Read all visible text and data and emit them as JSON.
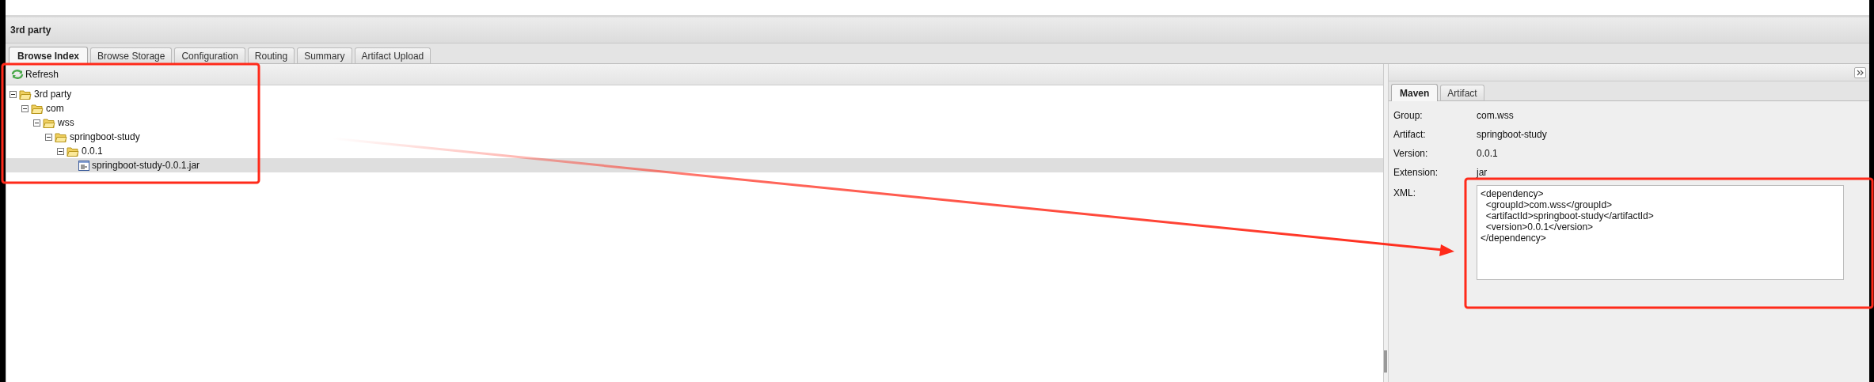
{
  "panel": {
    "title": "3rd party"
  },
  "tabs": [
    {
      "label": "Browse Index",
      "selected": true
    },
    {
      "label": "Browse Storage",
      "selected": false
    },
    {
      "label": "Configuration",
      "selected": false
    },
    {
      "label": "Routing",
      "selected": false
    },
    {
      "label": "Summary",
      "selected": false
    },
    {
      "label": "Artifact Upload",
      "selected": false
    }
  ],
  "toolbar": {
    "refresh": "Refresh"
  },
  "tree": [
    {
      "label": "3rd party",
      "kind": "folder",
      "expanded": true,
      "selected": false,
      "children": [
        {
          "label": "com",
          "kind": "folder",
          "expanded": true,
          "selected": false,
          "children": [
            {
              "label": "wss",
              "kind": "folder",
              "expanded": true,
              "selected": false,
              "children": [
                {
                  "label": "springboot-study",
                  "kind": "folder",
                  "expanded": true,
                  "selected": false,
                  "children": [
                    {
                      "label": "0.0.1",
                      "kind": "folder",
                      "expanded": true,
                      "selected": false,
                      "children": [
                        {
                          "label": "springboot-study-0.0.1.jar",
                          "kind": "file",
                          "selected": true
                        }
                      ]
                    }
                  ]
                }
              ]
            }
          ]
        }
      ]
    }
  ],
  "detail_tabs": [
    {
      "label": "Maven",
      "selected": true
    },
    {
      "label": "Artifact",
      "selected": false
    }
  ],
  "fields": [
    {
      "label": "Group:",
      "value": "com.wss"
    },
    {
      "label": "Artifact:",
      "value": "springboot-study"
    },
    {
      "label": "Version:",
      "value": "0.0.1"
    },
    {
      "label": "Extension:",
      "value": "jar"
    }
  ],
  "xml": {
    "label": "XML:",
    "value": "<dependency>\n  <groupId>com.wss</groupId>\n  <artifactId>springboot-study</artifactId>\n  <version>0.0.1</version>\n</dependency>"
  }
}
